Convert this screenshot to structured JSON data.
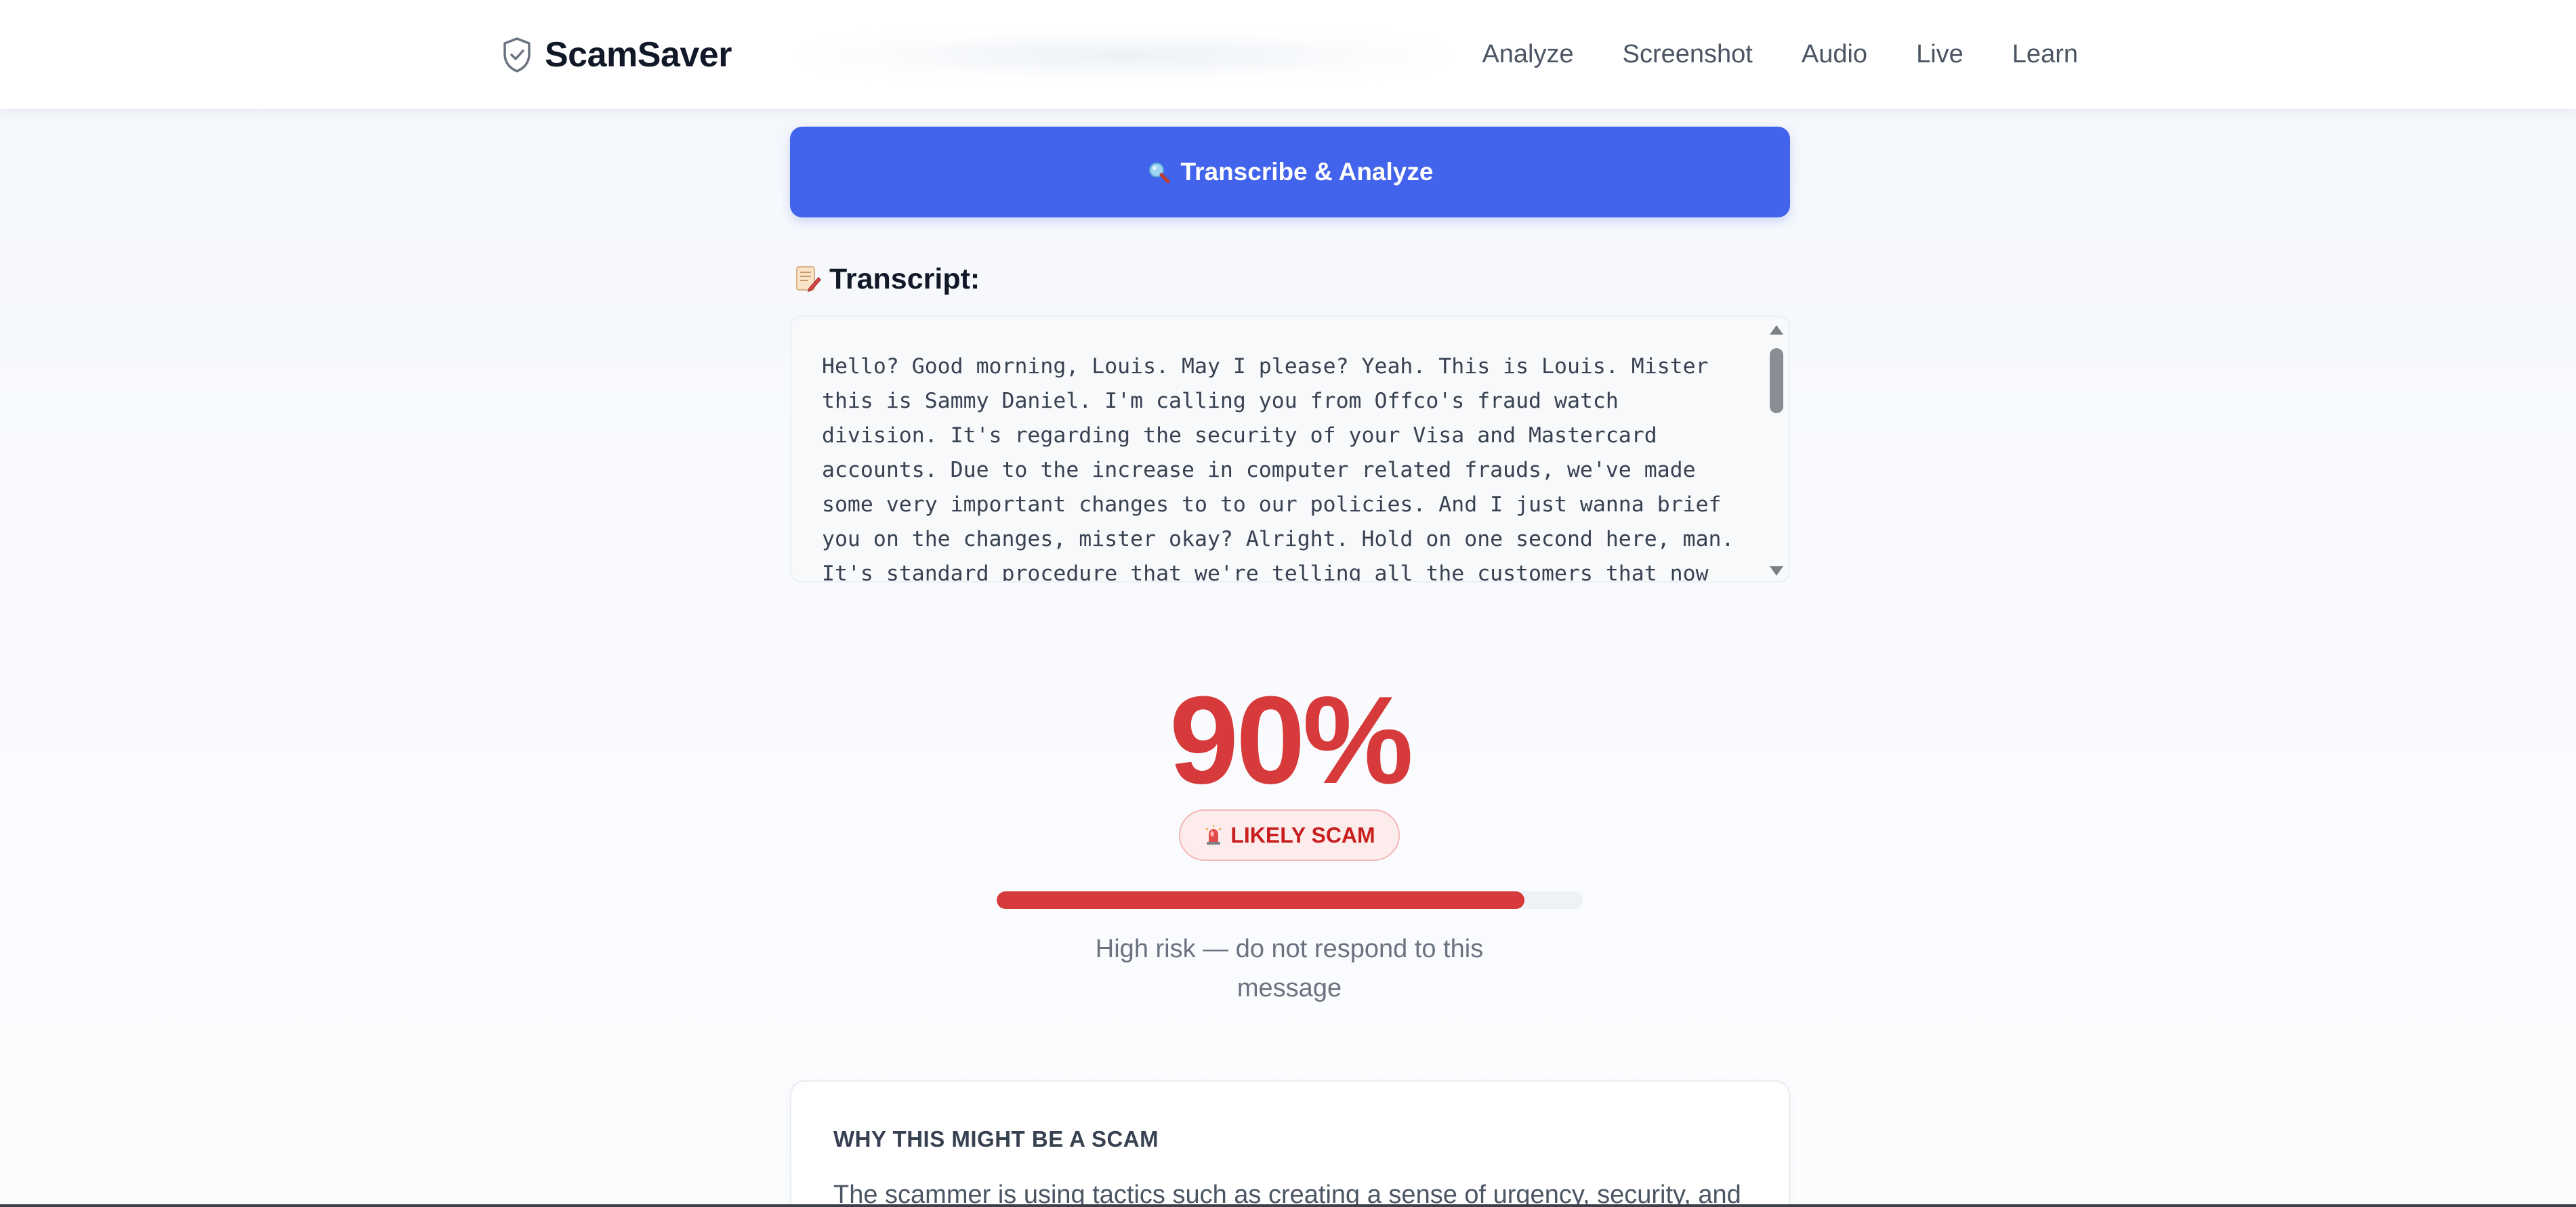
{
  "header": {
    "brand": "ScamSaver",
    "brand_icon": "shield-check-icon",
    "nav": [
      "Analyze",
      "Screenshot",
      "Audio",
      "Live",
      "Learn"
    ]
  },
  "main": {
    "action_button": "Transcribe & Analyze",
    "action_icon": "magnifier-icon",
    "transcript_heading": "Transcript:",
    "transcript_icon": "memo-icon",
    "transcript_text": "Hello? Good morning, Louis. May I please? Yeah. This is Louis. Mister this is Sammy Daniel. I'm calling you from Offco's fraud watch division. It's regarding the security of your Visa and Mastercard accounts. Due to the increase in computer related frauds, we've made some very important changes to to our policies. And I just wanna brief you on the changes, mister okay? Alright. Hold on one second here, man. It's standard procedure that we're telling all the customers that now"
  },
  "result": {
    "score": "90%",
    "badge": "LIKELY SCAM",
    "badge_icon": "siren-icon",
    "risk_fraction": 0.9,
    "risk_message": "High risk — do not respond to this message"
  },
  "why": {
    "title": "WHY THIS MIGHT BE A SCAM",
    "body": "The scammer is using tactics such as creating a sense of urgency, security, and"
  },
  "colors": {
    "accent_blue": "#4263eb",
    "danger_red": "#d63a3a",
    "badge_bg": "#fdecec"
  }
}
